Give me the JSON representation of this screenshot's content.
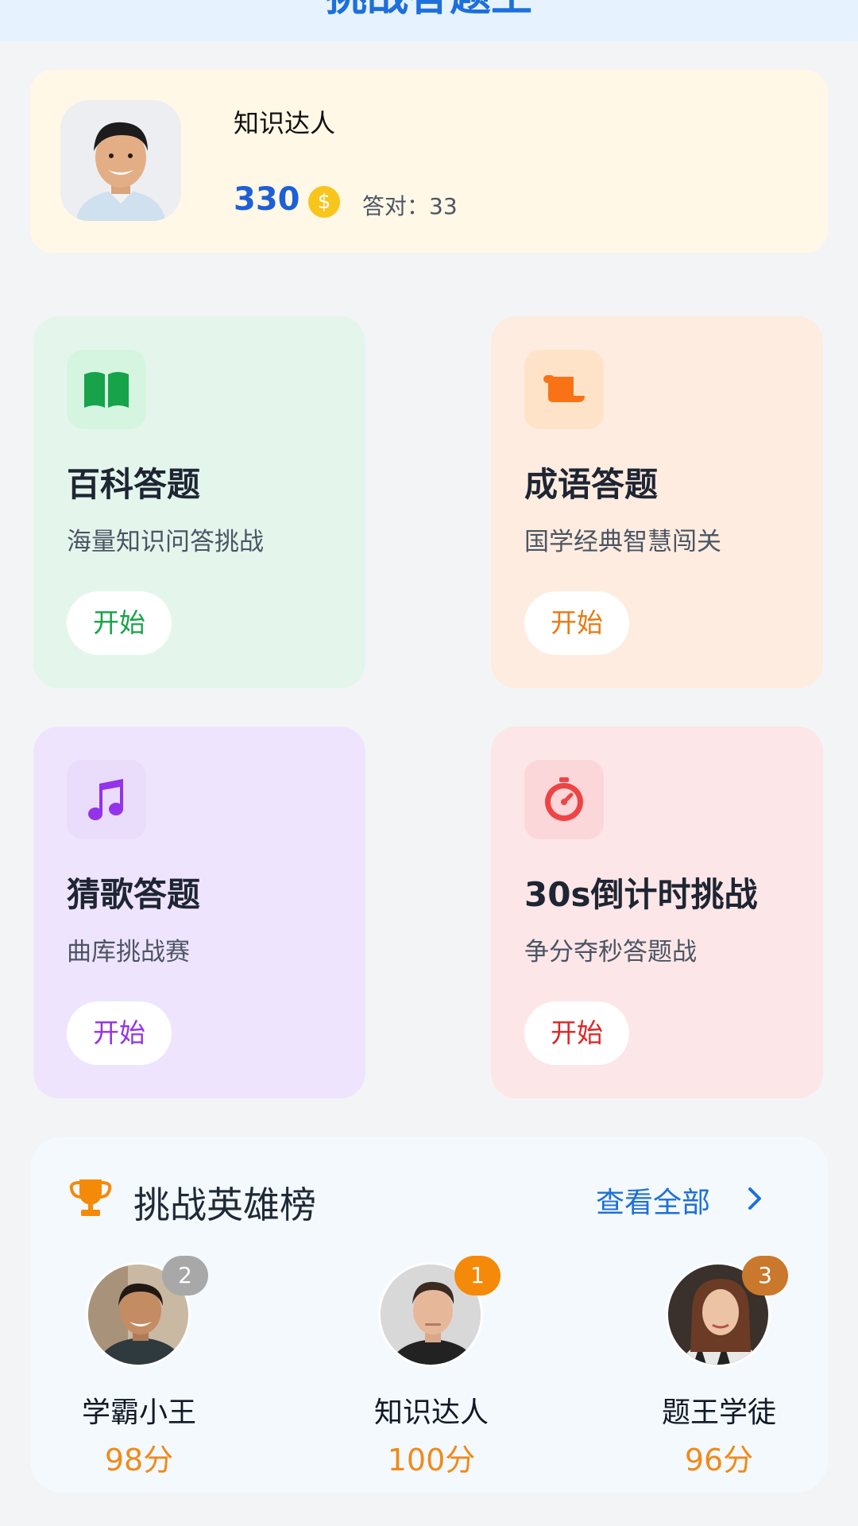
{
  "header": {
    "title": "挑战答题王"
  },
  "profile": {
    "name": "知识达人",
    "score": "330",
    "coin_icon": "coin-icon",
    "correct_label": "答对：33"
  },
  "quizzes": [
    {
      "title": "百科答题",
      "subtitle": "海量知识问答挑战",
      "button": "开始",
      "icon": "book-icon",
      "accent": "#16a34a"
    },
    {
      "title": "成语答题",
      "subtitle": "国学经典智慧闯关",
      "button": "开始",
      "icon": "scroll-icon",
      "accent": "#ea7a12"
    },
    {
      "title": "猜歌答题",
      "subtitle": "曲库挑战赛",
      "button": "开始",
      "icon": "music-icon",
      "accent": "#9333ea"
    },
    {
      "title": "30s倒计时挑战",
      "subtitle": "争分夺秒答题战",
      "button": "开始",
      "icon": "stopwatch-icon",
      "accent": "#dc2626"
    }
  ],
  "leaderboard": {
    "title": "挑战英雄榜",
    "view_all": "查看全部",
    "entries": [
      {
        "rank": "2",
        "name": "学霸小王",
        "score": "98分"
      },
      {
        "rank": "1",
        "name": "知识达人",
        "score": "100分"
      },
      {
        "rank": "3",
        "name": "题王学徒",
        "score": "96分"
      }
    ]
  },
  "colors": {
    "primary": "#1d6fdc",
    "gold": "#f58a0a",
    "score": "#f08a1a"
  }
}
